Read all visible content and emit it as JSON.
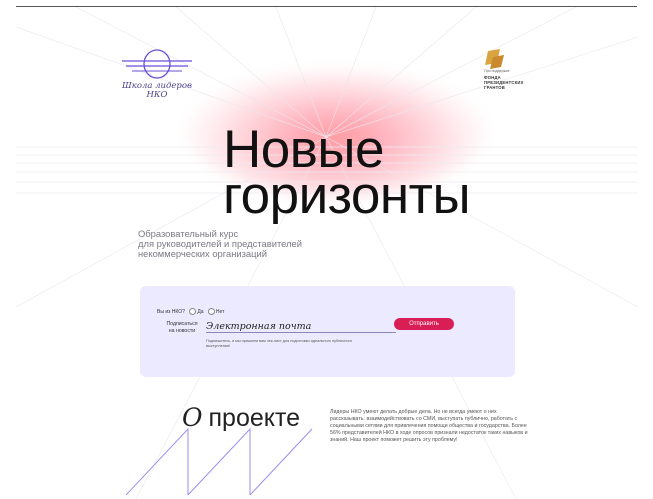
{
  "brand": {
    "logo_lines": [
      "Школа лидеров",
      "НКО"
    ]
  },
  "partner": {
    "pre": "При поддержке",
    "name_lines": [
      "ФОНДА",
      "ПРЕЗИДЕНТСКИХ",
      "ГРАНТОВ"
    ]
  },
  "hero": {
    "title_lines": [
      "Новые",
      "горизонты"
    ],
    "subtitle_lines": [
      "Образовательный курс",
      "для руководителей и представителей",
      "некоммерческих организаций"
    ]
  },
  "form": {
    "question": "Вы из НКО?",
    "option_yes": "Да",
    "option_no": "Нет",
    "subscribe_lines": [
      "Подписаться",
      "на новости"
    ],
    "email_placeholder": "Электронная почта",
    "submit_label": "Отправить",
    "note": "Подпишитесь, и мы пришлем вам чек-лист для подготовки идеального публичного выступления!"
  },
  "about": {
    "title_o": "О",
    "title_rest": "проекте",
    "text": "Лидеры НКО умеют делать добрые дела. Но не всегда умеют о них рассказывать: взаимодействовать со СМИ, выступать публично, работать с социальными сетями для привлечения помощи общества и государства. Более 56% представителей НКО в ходе опросов признали недостаток таких навыков и знаний. Наш проект поможет решить эту проблему!"
  },
  "colors": {
    "accent": "#d91e56",
    "form_bg": "#eceaff",
    "logo": "#6a4fd6",
    "glow": "#ff9aa0"
  }
}
